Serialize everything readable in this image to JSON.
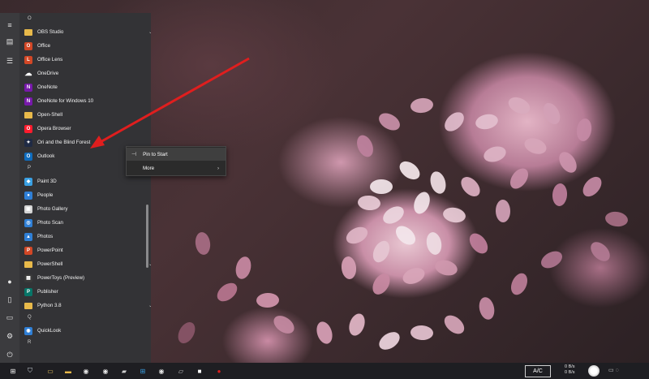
{
  "rail": {
    "icons": [
      "hamburger-icon",
      "tiles-icon",
      "list-icon",
      "user-icon",
      "document-icon",
      "pictures-icon",
      "settings-icon",
      "power-icon"
    ]
  },
  "applist": {
    "groups": [
      {
        "letter": "O",
        "apps": [
          {
            "label": "OBS Studio",
            "icon": "folder",
            "color": "#e8b94a",
            "expand": true
          },
          {
            "label": "Office",
            "icon": "office",
            "color": "#d24726",
            "expand": false
          },
          {
            "label": "Office Lens",
            "icon": "officelens",
            "color": "#d24726",
            "expand": false
          },
          {
            "label": "OneDrive",
            "icon": "cloud",
            "color": "#ffffff",
            "expand": false
          },
          {
            "label": "OneNote",
            "icon": "onenote",
            "color": "#7719aa",
            "expand": false
          },
          {
            "label": "OneNote for Windows 10",
            "icon": "onenote",
            "color": "#7719aa",
            "expand": false
          },
          {
            "label": "Open-Shell",
            "icon": "folder",
            "color": "#e8b94a",
            "expand": false
          },
          {
            "label": "Opera Browser",
            "icon": "opera",
            "color": "#ff1b2d",
            "expand": false
          },
          {
            "label": "Ori and the Blind Forest",
            "icon": "ori",
            "color": "#1f2a44",
            "expand": false
          },
          {
            "label": "Outlook",
            "icon": "outlook",
            "color": "#0f6cbd",
            "expand": false
          }
        ]
      },
      {
        "letter": "P",
        "apps": [
          {
            "label": "Paint 3D",
            "icon": "paint3d",
            "color": "#3aa0e3",
            "expand": false
          },
          {
            "label": "People",
            "icon": "people",
            "color": "#2f7fd6",
            "expand": false
          },
          {
            "label": "Photo Gallery",
            "icon": "gallery",
            "color": "#d4d4d4",
            "expand": false
          },
          {
            "label": "Photo Scan",
            "icon": "scan",
            "color": "#2f7fd6",
            "expand": false
          },
          {
            "label": "Photos",
            "icon": "photos",
            "color": "#2f7fd6",
            "expand": false
          },
          {
            "label": "PowerPoint",
            "icon": "powerpoint",
            "color": "#d24726",
            "expand": false
          },
          {
            "label": "PowerShell",
            "icon": "folder",
            "color": "#e8b94a",
            "expand": true
          },
          {
            "label": "PowerToys (Preview)",
            "icon": "powertoys",
            "color": "#3a3a3a",
            "expand": false
          },
          {
            "label": "Publisher",
            "icon": "publisher",
            "color": "#077568",
            "expand": false
          },
          {
            "label": "Python 3.8",
            "icon": "folder",
            "color": "#e8b94a",
            "expand": true
          }
        ]
      },
      {
        "letter": "Q",
        "apps": [
          {
            "label": "QuickLook",
            "icon": "quicklook",
            "color": "#2f7fd6",
            "expand": false
          }
        ]
      },
      {
        "letter": "R",
        "apps": []
      }
    ]
  },
  "context_menu": {
    "items": [
      {
        "label": "Pin to Start",
        "icon": "pin-icon",
        "submenu": false
      },
      {
        "label": "More",
        "icon": "",
        "submenu": true
      }
    ]
  },
  "taskbar": {
    "icons": [
      "start-icon",
      "shield-icon",
      "file-explorer-icon",
      "folder-icon",
      "chrome-icon",
      "chrome-icon",
      "windows-icon",
      "car-icon",
      "edge-icon",
      "chrome-icon",
      "scanner-icon",
      "terminal-icon",
      "record-icon"
    ],
    "keyboard_label": "A/C",
    "net_up": "0 B/s",
    "net_down": "0 B/s"
  },
  "colors": {
    "arrow": "#e01e1e",
    "menu_bg": "#333336",
    "rail_bg": "#3b3b3e",
    "taskbar_bg": "#1e1e22"
  }
}
